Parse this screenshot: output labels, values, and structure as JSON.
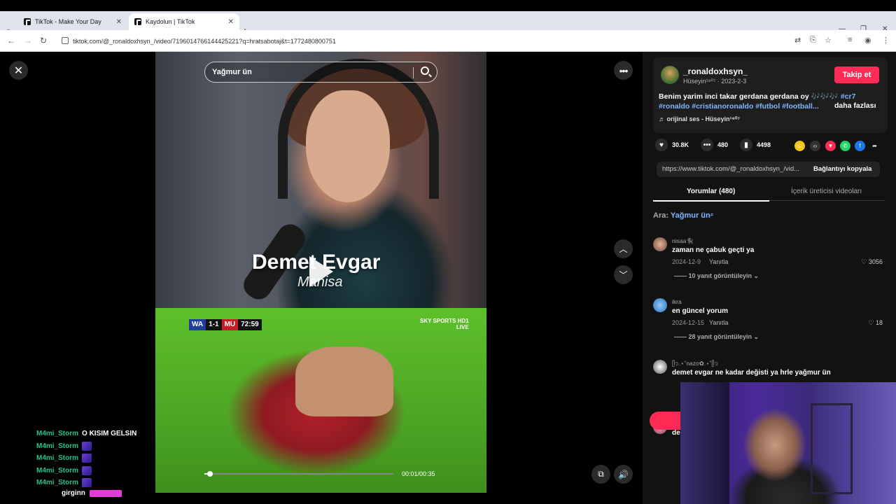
{
  "browser": {
    "tabs": [
      {
        "label": "TikTok - Make Your Day"
      },
      {
        "label": "Kaydolun | TikTok"
      }
    ],
    "url": "tiktok.com/@_ronaldoxhsyn_/video/7196014766144425221?q=hratsabotaj&t=1772480800751"
  },
  "search": {
    "query": "Yağmur ün"
  },
  "video": {
    "caption_name": "Demet Evgar",
    "caption_role": "Manisa",
    "score": {
      "home": "WA",
      "score": "1-1",
      "away": "MU",
      "time": "72:59"
    },
    "channel_logo": [
      "SKY SPORTS HD1",
      "LIVE"
    ],
    "time": "00:01/00:35",
    "progress_fraction": 0.03
  },
  "chat": {
    "lines": [
      {
        "user": "M4mi_Storm",
        "message": "O KISIM GELSIN"
      },
      {
        "user": "M4mi_Storm",
        "message": ""
      },
      {
        "user": "M4mi_Storm",
        "message": ""
      },
      {
        "user": "M4mi_Storm",
        "message": ""
      },
      {
        "user": "M4mi_Storm",
        "message": ""
      }
    ],
    "last_line": "girginn"
  },
  "creator": {
    "name": "_ronaldoxhsyn_",
    "meta": "Hüseyin¹⁹⁰⁷ · 2023-2-3",
    "follow_label": "Takip et",
    "caption_line1": "Benim yarim inci takar gerdana gerdana oy 🎶🎶🎶 ",
    "caption_tag1": "#cr7",
    "caption_line2_tags": "#ronaldo #cristianoronaldo #futbol #football...",
    "more_label": "daha fazlası",
    "sound": "♬ orijinal ses - Hüseyin¹⁹⁰⁷"
  },
  "actions": {
    "likes": "30.8K",
    "comments": "480",
    "saves": "4498"
  },
  "link": {
    "text": "https://www.tiktok.com/@_ronaldoxhsyn_/vid...",
    "copy_label": "Bağlantıyı kopyala"
  },
  "panel_tabs": {
    "comments": "Yorumlar (480)",
    "creator_videos": "İçerik üreticisi videoları"
  },
  "search_related": {
    "prefix": "Ara: ",
    "query": "Yağmur ün"
  },
  "comments": [
    {
      "user": "nisaa🐈‍⬛",
      "text": "zaman ne çabuk geçti ya",
      "date": "2024-12-9",
      "reply": "Yanıtla",
      "likes": "♡ 3056",
      "more": "—— 10 yanıt görüntüleyin ⌄"
    },
    {
      "user": "ikra",
      "text": "en güncel yorum",
      "date": "2024-12-15",
      "reply": "Yanıtla",
      "likes": "♡ 18",
      "more": "—— 28 yanıt görüntüleyin ⌄"
    },
    {
      "user": "ᥫ᭡.⋆˚nazo✿.⋆˚ᥫ᭡",
      "text": "demet evgar ne kadar değisti ya hrle yağmur ün",
      "date": "",
      "reply": "",
      "likes": "",
      "more": ""
    },
    {
      "user": "me",
      "text": "de",
      "date": "",
      "reply": "",
      "likes": "",
      "more": ""
    }
  ],
  "colors": {
    "accent": "#fe2c55",
    "hashtag": "#7fb6ff",
    "chat_user": "#23c48c"
  }
}
